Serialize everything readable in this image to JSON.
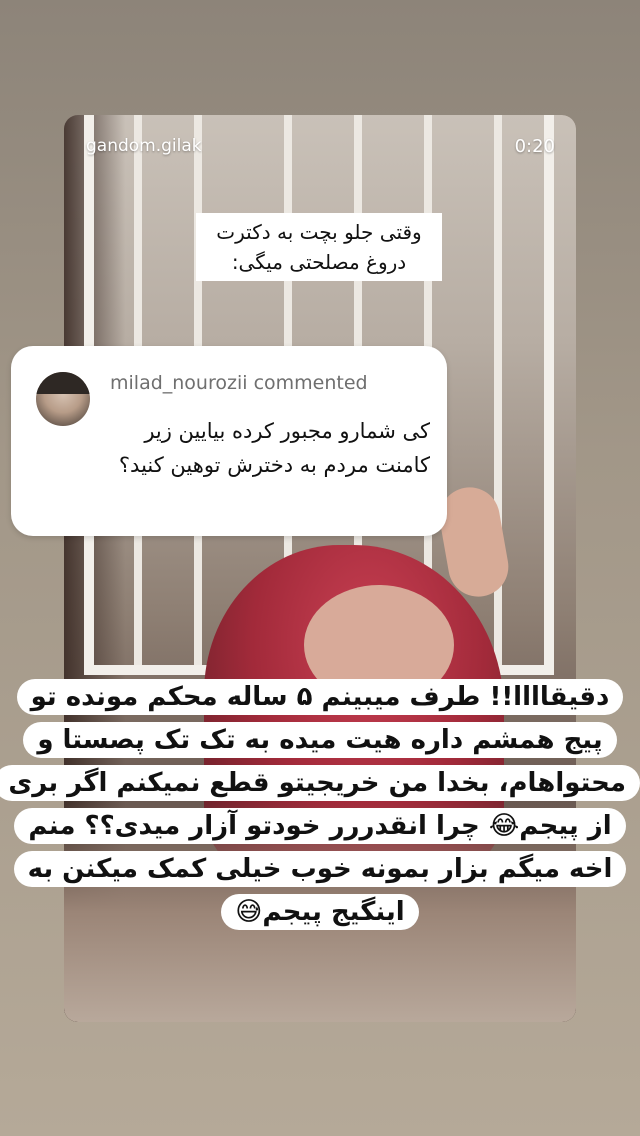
{
  "story": {
    "username": "gandom.gilak",
    "timer": "0:20",
    "caption": "وقتی جلو بچت به دکترت دروغ مصلحتی میگی:"
  },
  "comment": {
    "author_line": "milad_nourozii commented",
    "text": "کی شمارو مجبور کرده بیایین زیر کامنت مردم به دخترش توهین کنید؟"
  },
  "overlay": {
    "text": "دقیقاااا!! طرف میبینم ۵ ساله محکم مونده تو پیج همشم داره هیت میده به تک تک پصستا و محتواهام، بخدا من خریجیتو قطع نمیکنم اگر بری از پیجم😂 چرا انقدررر خودتو آزار میدی؟؟ منم اخه میگم بزار بمونه خوب خیلی کمک میکنن به اینگیج پیجم😅"
  },
  "icons": {
    "avatar": "user-avatar"
  }
}
